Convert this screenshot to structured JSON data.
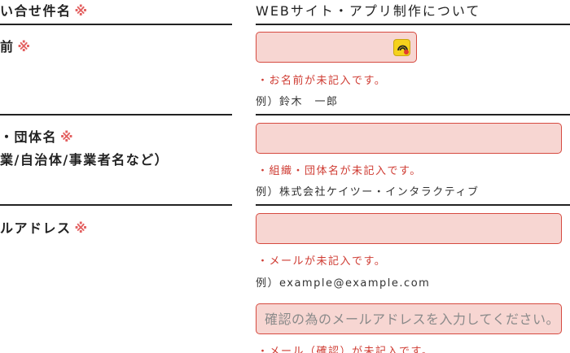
{
  "rows": {
    "subject": {
      "label": "い合せ件名",
      "required_mark": "※",
      "value": "WEBサイト・アプリ制作について"
    },
    "name": {
      "label": "前",
      "required_mark": "※",
      "error": "・お名前が未記入です。",
      "example": "例）鈴木　一郎",
      "value": ""
    },
    "organization": {
      "label": "・団体名",
      "required_mark": "※",
      "sublabel": "業/自治体/事業者名など）",
      "error": "・組織・団体名が未記入です。",
      "example": "例）株式会社ケイツー・インタラクティブ",
      "value": ""
    },
    "email": {
      "label": "ルアドレス",
      "required_mark": "※",
      "error": "・メールが未記入です。",
      "example": "例）example@example.com",
      "value": "",
      "confirm_placeholder": "確認の為のメールアドレスを入力してください。",
      "confirm_value": "",
      "confirm_error": "・メール（確認）が未記入です。"
    }
  },
  "icons": {
    "autofill": "autofill-extension-icon"
  },
  "colors": {
    "error_text": "#cf3b32",
    "field_bg": "#f7d6d2",
    "field_border": "#d64a40",
    "required_mark": "#e36060"
  }
}
